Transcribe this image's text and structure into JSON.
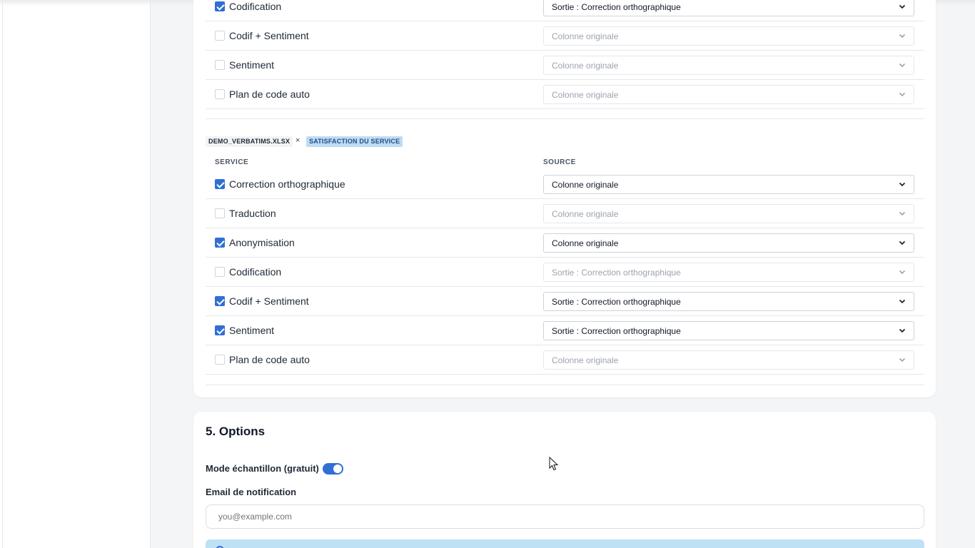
{
  "group1": {
    "rows": [
      {
        "label": "Codification",
        "checked": true,
        "source": "Sortie : Correction orthographique",
        "active": true
      },
      {
        "label": "Codif + Sentiment",
        "checked": false,
        "source": "Colonne originale",
        "active": false
      },
      {
        "label": "Sentiment",
        "checked": false,
        "source": "Colonne originale",
        "active": false
      },
      {
        "label": "Plan de code auto",
        "checked": false,
        "source": "Colonne originale",
        "active": false
      }
    ]
  },
  "group2": {
    "file_tag": "DEMO_VERBATIMS.XLSX",
    "separator": "×",
    "column_tag": "SATISFACTION DU SERVICE",
    "header_service": "SERVICE",
    "header_source": "SOURCE",
    "rows": [
      {
        "label": "Correction orthographique",
        "checked": true,
        "source": "Colonne originale",
        "active": true
      },
      {
        "label": "Traduction",
        "checked": false,
        "source": "Colonne originale",
        "active": false
      },
      {
        "label": "Anonymisation",
        "checked": true,
        "source": "Colonne originale",
        "active": true
      },
      {
        "label": "Codification",
        "checked": false,
        "source": "Sortie : Correction orthographique",
        "active": false
      },
      {
        "label": "Codif + Sentiment",
        "checked": true,
        "source": "Sortie : Correction orthographique",
        "active": true
      },
      {
        "label": "Sentiment",
        "checked": true,
        "source": "Sortie : Correction orthographique",
        "active": true
      },
      {
        "label": "Plan de code auto",
        "checked": false,
        "source": "Colonne originale",
        "active": false
      }
    ]
  },
  "options": {
    "title": "5. Options",
    "sample_mode_label": "Mode échantillon (gratuit)",
    "sample_mode_on": true,
    "email_label": "Email de notification",
    "email_placeholder": "you@example.com"
  },
  "colors": {
    "accent": "#2f6fd6",
    "tag_column_bg": "#bfdbf4",
    "info_banner_bg": "#bfe1f5"
  }
}
